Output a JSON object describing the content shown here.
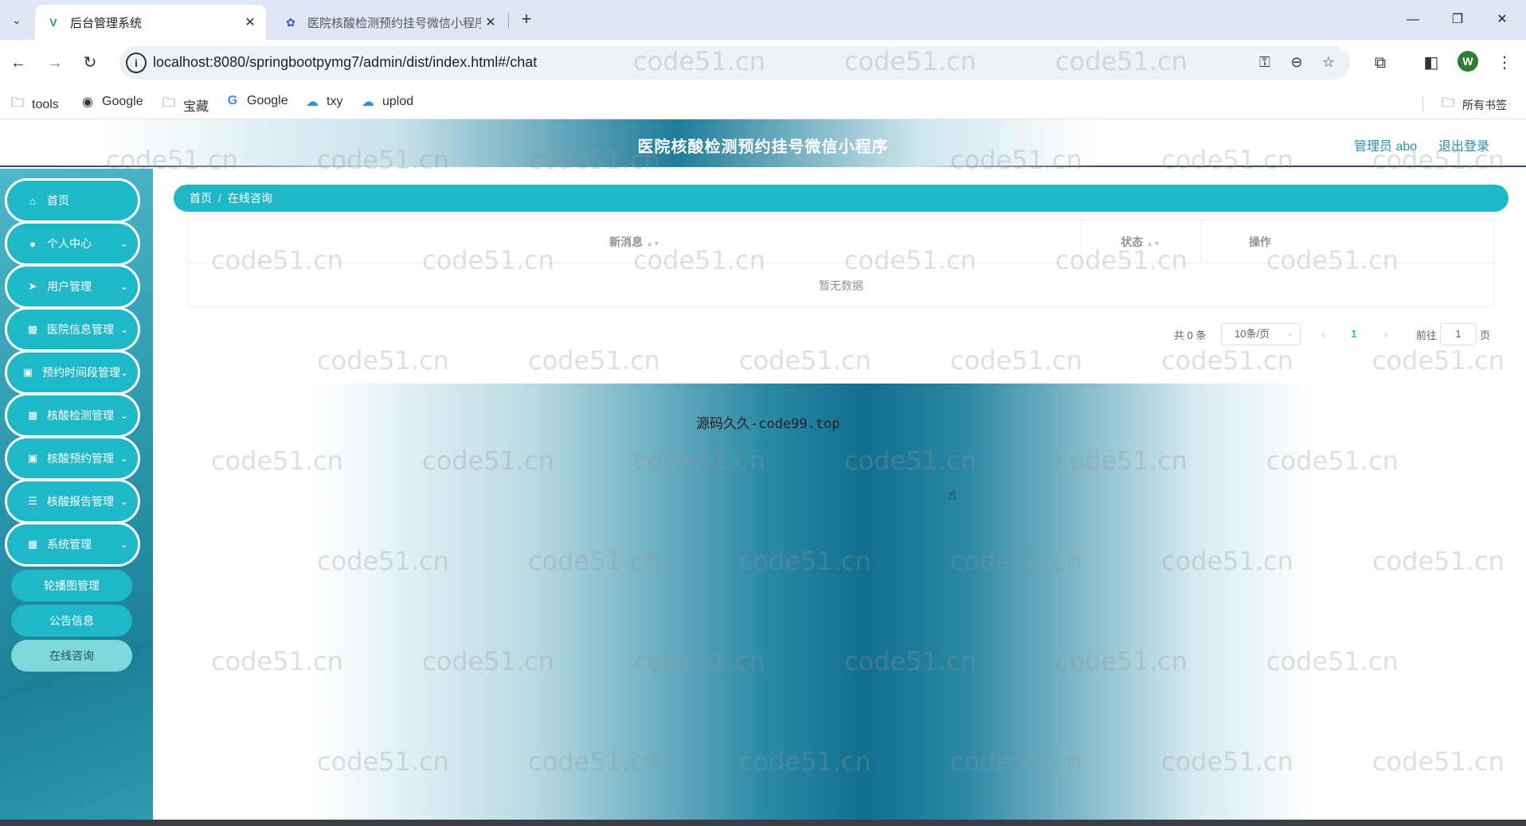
{
  "browser": {
    "tabs": [
      {
        "title": "后台管理系统",
        "favicon": "vue-v-icon",
        "active": true
      },
      {
        "title": "医院核酸检测预约挂号微信小程序",
        "favicon": "paw-icon",
        "active": false
      }
    ],
    "new_tab": "+",
    "url": "localhost:8080/springbootpymg7/admin/dist/index.html#/chat",
    "profile_initial": "W",
    "bookmarks": [
      {
        "label": "tools",
        "icon": "folder-icon"
      },
      {
        "label": "Google",
        "icon": "globe-icon"
      },
      {
        "label": "宝藏",
        "icon": "folder-icon"
      },
      {
        "label": "Google",
        "icon": "google-g-icon"
      },
      {
        "label": "txy",
        "icon": "cloud-icon"
      },
      {
        "label": "uplod",
        "icon": "cloud-upload-icon"
      }
    ],
    "all_bookmarks": "所有书签"
  },
  "app": {
    "title": "医院核酸检测预约挂号微信小程序",
    "user": "管理员 abo",
    "logout": "退出登录",
    "accent": "#1fb8c8",
    "menu": [
      {
        "label": "首页",
        "icon": "home-icon",
        "has_children": false
      },
      {
        "label": "个人中心",
        "icon": "user-icon",
        "has_children": true
      },
      {
        "label": "用户管理",
        "icon": "send-icon",
        "has_children": true
      },
      {
        "label": "医院信息管理",
        "icon": "grid-icon",
        "has_children": true
      },
      {
        "label": "预约时间段管理",
        "icon": "clipboard-icon",
        "has_children": true
      },
      {
        "label": "核酸检测管理",
        "icon": "grid-icon",
        "has_children": true
      },
      {
        "label": "核酸预约管理",
        "icon": "clipboard-icon",
        "has_children": true
      },
      {
        "label": "核酸报告管理",
        "icon": "sliders-icon",
        "has_children": true
      },
      {
        "label": "系统管理",
        "icon": "grid-icon",
        "has_children": true
      }
    ],
    "submenu": [
      {
        "label": "轮播图管理",
        "selected": false
      },
      {
        "label": "公告信息",
        "selected": false
      },
      {
        "label": "在线咨询",
        "selected": true
      }
    ],
    "breadcrumb": [
      "首页",
      "在线咨询"
    ],
    "breadcrumb_sep": "/",
    "table": {
      "columns": [
        "新消息",
        "状态",
        "操作"
      ],
      "empty_text": "暂无数据"
    },
    "pagination": {
      "total": "共 0 条",
      "page_size": "10条/页",
      "current_page": "1",
      "goto_prefix": "前往",
      "goto_value": "1",
      "goto_suffix": "页"
    },
    "overlay_text": "源码久久-code99.top",
    "watermark": "code51.cn"
  }
}
